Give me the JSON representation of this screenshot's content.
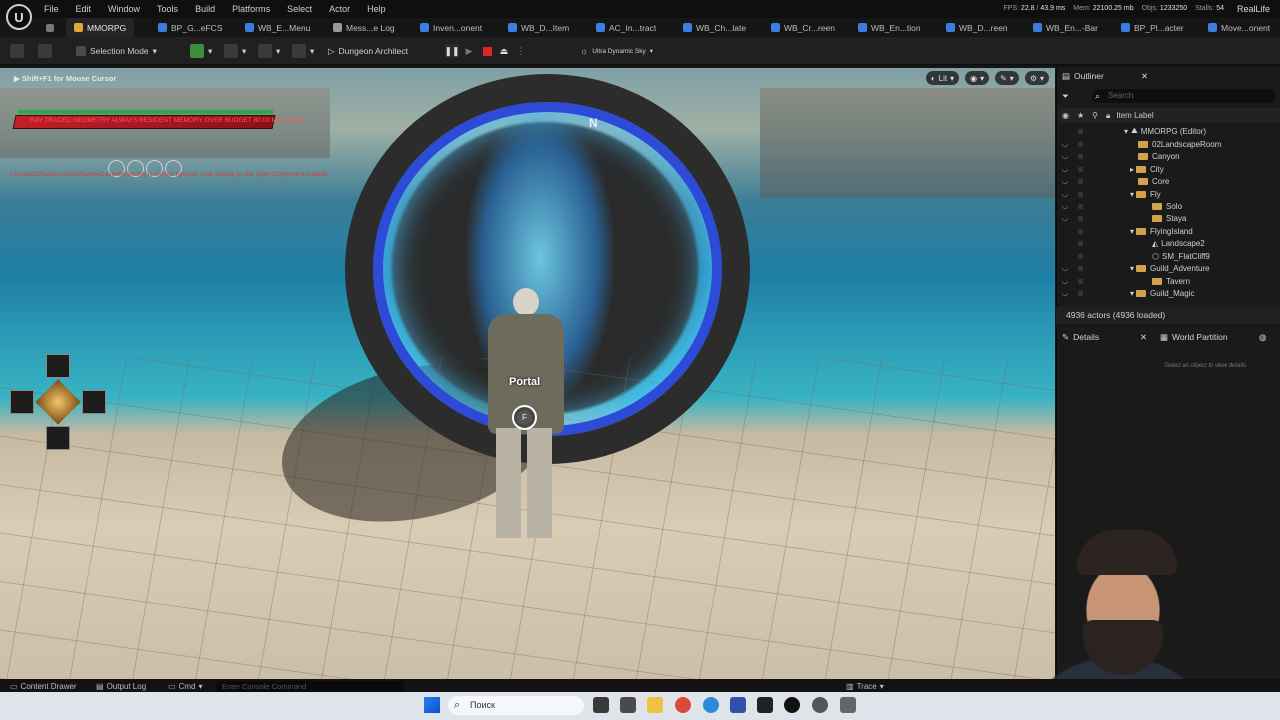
{
  "menubar": {
    "items": [
      "File",
      "Edit",
      "Window",
      "Tools",
      "Build",
      "Platforms",
      "Select",
      "Actor",
      "Help"
    ],
    "perf": {
      "fps_label": "FPS:",
      "fps": "22.8",
      "ms": "43.9 ms",
      "mem_label": "Mem:",
      "mem": "22100.25 mb",
      "objs_label": "Objs:",
      "objs": "1233250",
      "stalls_label": "Stalls:",
      "stalls": "54"
    },
    "project": "RealLife"
  },
  "tabs": [
    {
      "label": "MMORPG",
      "color": "#e8a33a"
    },
    {
      "label": "BP_G...eFCS",
      "color": "#3c7ee0"
    },
    {
      "label": "WB_E...Menu",
      "color": "#3c7ee0"
    },
    {
      "label": "Mess...e Log",
      "color": "#9a9a9a"
    },
    {
      "label": "Inven...onent",
      "color": "#3c7ee0"
    },
    {
      "label": "WB_D...Item",
      "color": "#3c7ee0"
    },
    {
      "label": "AC_In...tract",
      "color": "#3c7ee0"
    },
    {
      "label": "WB_Ch...late",
      "color": "#3c7ee0"
    },
    {
      "label": "WB_Cr...reen",
      "color": "#3c7ee0"
    },
    {
      "label": "WB_En...tion",
      "color": "#3c7ee0"
    },
    {
      "label": "WB_D...reen",
      "color": "#3c7ee0"
    },
    {
      "label": "WB_En...-Bar",
      "color": "#3c7ee0"
    },
    {
      "label": "BP_Pl...acter",
      "color": "#3c7ee0"
    },
    {
      "label": "Move...onent",
      "color": "#3c7ee0"
    }
  ],
  "toolbar": {
    "selection_mode": "Selection Mode",
    "dungeon_architect": "Dungeon Architect",
    "sky": "Ultra Dynamic Sky"
  },
  "viewport": {
    "hint": "Shift+F1 for Mouse Cursor",
    "lit_label": "Lit",
    "warning_bar": "RAY TRACED GEOMETRY ALWAYS RESIDENT MEMORY OVER BUDGET 80.03 MB / 64 MB",
    "warning_line": "r.ContactShadows.NonShadowCastingIntensity is set but ignored. Use setting on the Light Component instead.",
    "compass": "N",
    "prompt_label": "Portal",
    "prompt_key": "F"
  },
  "outliner": {
    "title": "Outliner",
    "search_placeholder": "Search",
    "column": "Item Label",
    "rows": [
      {
        "label": "MMORPG (Editor)",
        "depth": 0,
        "kind": "world"
      },
      {
        "label": "02LandscapeRoom",
        "depth": 1,
        "kind": "folder"
      },
      {
        "label": "Canyon",
        "depth": 1,
        "kind": "folder"
      },
      {
        "label": "City",
        "depth": 1,
        "kind": "folder"
      },
      {
        "label": "Core",
        "depth": 1,
        "kind": "folder"
      },
      {
        "label": "Fly",
        "depth": 1,
        "kind": "folder"
      },
      {
        "label": "Solo",
        "depth": 2,
        "kind": "folder"
      },
      {
        "label": "Staya",
        "depth": 2,
        "kind": "folder"
      },
      {
        "label": "FlyingIsland",
        "depth": 1,
        "kind": "folder"
      },
      {
        "label": "Landscape2",
        "depth": 2,
        "kind": "mesh"
      },
      {
        "label": "SM_FlatCliff9",
        "depth": 2,
        "kind": "mesh"
      },
      {
        "label": "Guild_Adventure",
        "depth": 1,
        "kind": "folder"
      },
      {
        "label": "Tavern",
        "depth": 2,
        "kind": "folder"
      },
      {
        "label": "Guild_Magic",
        "depth": 1,
        "kind": "folder"
      }
    ],
    "actors": "4936 actors (4936 loaded)"
  },
  "details": {
    "title": "Details",
    "world_partition": "World Partition",
    "hint": "Select an object to view details."
  },
  "bottombar": {
    "content_drawer": "Content Drawer",
    "output_log": "Output Log",
    "cmd": "Cmd",
    "console_placeholder": "Enter Console Command",
    "trace": "Trace"
  },
  "taskbar": {
    "search": "Поиск"
  }
}
